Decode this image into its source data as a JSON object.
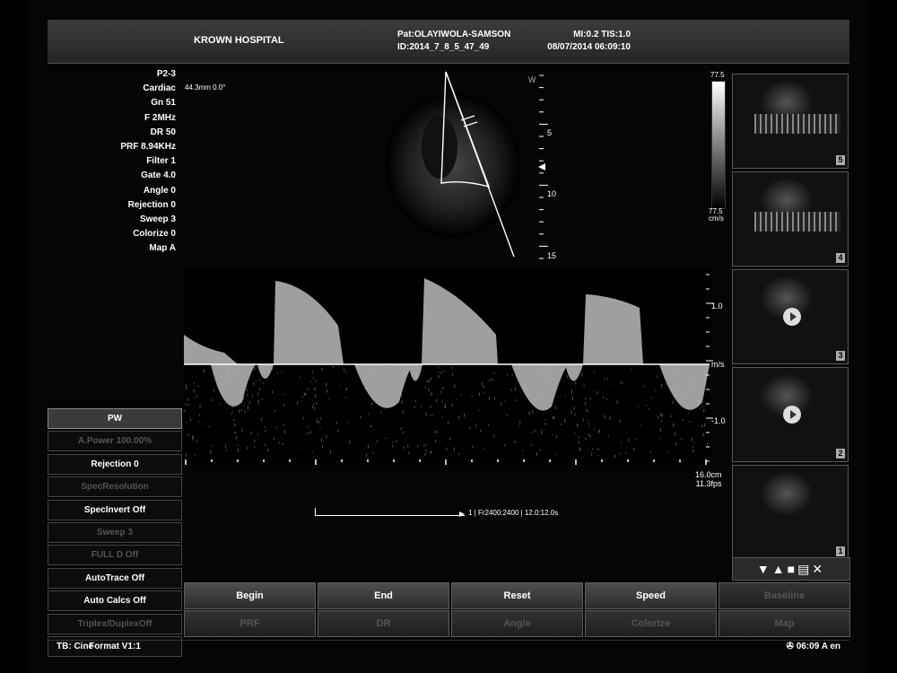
{
  "header": {
    "hospital": "KROWN HOSPITAL",
    "patient": "Pat:OLAYIWOLA-SAMSON",
    "id": "ID:2014_7_8_5_47_49",
    "mi_tis": "MI:0.2 TIS:1.0",
    "datetime": "08/07/2014 06:09:10"
  },
  "params": [
    "P2-3",
    "Cardiac",
    "Gn 51",
    "F 2MHz",
    "DR 50",
    "PRF 8.94KHz",
    "Filter 1",
    "Gate 4.0",
    "Angle 0",
    "Rejection 0",
    "Sweep 3",
    "Colorize 0",
    "Map A"
  ],
  "image": {
    "depth_info": "44.3mm   0.0°",
    "depth_marks": [
      "5",
      "10",
      "15"
    ],
    "colorbar_top": "77.5",
    "colorbar_bottom": "77.5",
    "colorbar_unit": "cm/s",
    "velocity_scale": [
      "1.0",
      "m/s",
      "-1.0"
    ],
    "depth_total": "16.0cm",
    "frame_rate": "11.3fps",
    "cine_info": "1 | Fr2400:2400 | 12.0:12.0s"
  },
  "menu": [
    {
      "label": "PW",
      "state": "selected"
    },
    {
      "label": "A.Power 100.00%",
      "state": "disabled"
    },
    {
      "label": "Rejection  0",
      "state": "enabled"
    },
    {
      "label": "SpecResolution",
      "state": "disabled"
    },
    {
      "label": "SpecInvert  Off",
      "state": "enabled"
    },
    {
      "label": "Sweep  3",
      "state": "disabled"
    },
    {
      "label": "FULL D  Off",
      "state": "disabled"
    },
    {
      "label": "AutoTrace  Off",
      "state": "enabled"
    },
    {
      "label": "Auto Calcs  Off",
      "state": "enabled"
    },
    {
      "label": "Triplex/DuplexOff",
      "state": "disabled"
    },
    {
      "label": "Format  V1:1",
      "state": "enabled"
    }
  ],
  "softkeys": {
    "row1": [
      {
        "label": "Begin",
        "enabled": true
      },
      {
        "label": "End",
        "enabled": true
      },
      {
        "label": "Reset",
        "enabled": true
      },
      {
        "label": "Speed",
        "enabled": true
      },
      {
        "label": "Baseline",
        "enabled": false
      }
    ],
    "row2": [
      {
        "label": "PRF",
        "enabled": false
      },
      {
        "label": "DR",
        "enabled": false
      },
      {
        "label": "Angle",
        "enabled": false
      },
      {
        "label": "Colorize",
        "enabled": false
      },
      {
        "label": "Map",
        "enabled": false
      }
    ]
  },
  "thumbnails": [
    "5",
    "4",
    "3",
    "2",
    "1"
  ],
  "toolbar_icons": [
    "arrow-down-circle-icon",
    "arrow-up-circle-icon",
    "save-icon",
    "print-icon",
    "delete-icon"
  ],
  "status": {
    "tb": "TB: Cine",
    "time": "06:09",
    "lang": "A  en"
  }
}
